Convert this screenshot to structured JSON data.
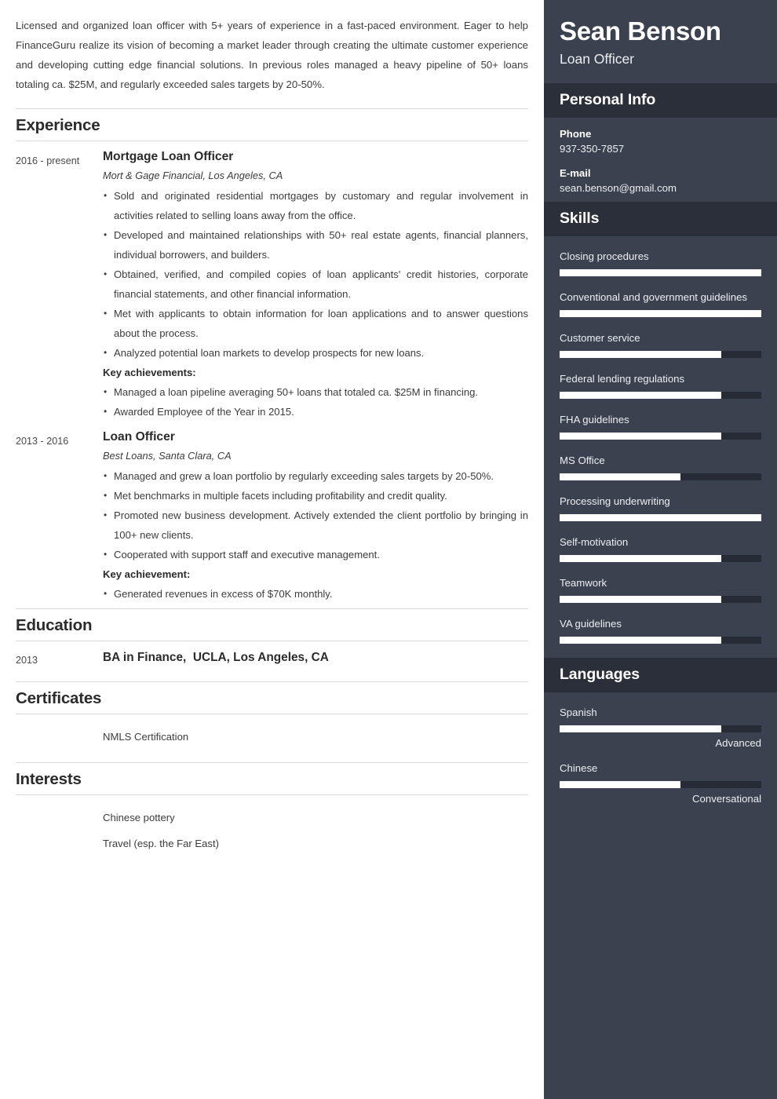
{
  "summary": "Licensed and organized loan officer with 5+ years of experience in a fast-paced environment. Eager to help FinanceGuru realize its vision of becoming a market leader through creating the ultimate customer experience and developing cutting edge financial solutions. In previous roles managed a heavy pipeline of 50+ loans totaling ca. $25M, and regularly exceeded sales targets by 20-50%.",
  "sections": {
    "experience_title": "Experience",
    "education_title": "Education",
    "certificates_title": "Certificates",
    "interests_title": "Interests"
  },
  "experience": [
    {
      "date": "2016 - present",
      "title": "Mortgage Loan Officer",
      "meta": "Mort & Gage Financial, Los Angeles, CA",
      "bullets": [
        "Sold and originated residential mortgages by customary and regular involvement in activities related to selling loans away from the office.",
        "Developed and maintained relationships with 50+ real estate agents, financial planners, individual borrowers, and builders.",
        "Obtained, verified, and compiled copies of loan applicants' credit histories, corporate financial statements, and other financial information.",
        "Met with applicants to obtain information for loan applications and to answer questions about the process.",
        "Analyzed potential loan markets to develop prospects for new loans."
      ],
      "achievements_label": "Key achievements:",
      "achievements": [
        "Managed a loan pipeline averaging 50+ loans that totaled ca. $25M in financing.",
        "Awarded Employee of the Year in 2015."
      ]
    },
    {
      "date": "2013 - 2016",
      "title": "Loan Officer",
      "meta": "Best Loans, Santa Clara, CA",
      "bullets": [
        "Managed and grew a loan portfolio by regularly exceeding sales targets by 20-50%.",
        "Met benchmarks in multiple facets including profitability and credit quality.",
        "Promoted new business development. Actively extended the client portfolio by bringing in 100+ new clients.",
        "Cooperated with support staff and executive management."
      ],
      "achievements_label": "Key achievement:",
      "achievements": [
        "Generated revenues in excess of $70K monthly."
      ]
    }
  ],
  "education": [
    {
      "date": "2013",
      "degree": "BA in Finance,  UCLA, Los Angeles, CA"
    }
  ],
  "certificates": [
    {
      "name": "NMLS Certification"
    }
  ],
  "interests": [
    {
      "name": "Chinese pottery"
    },
    {
      "name": "Travel (esp. the Far East)"
    }
  ],
  "sidebar": {
    "name": "Sean Benson",
    "role": "Loan Officer",
    "personal_info_title": "Personal Info",
    "phone_label": "Phone",
    "phone_value": "937-350-7857",
    "email_label": "E-mail",
    "email_value": "sean.benson@gmail.com",
    "skills_title": "Skills",
    "skills": [
      {
        "name": "Closing procedures",
        "level": 100
      },
      {
        "name": "Conventional and government guidelines",
        "level": 100
      },
      {
        "name": "Customer service",
        "level": 80
      },
      {
        "name": "Federal lending regulations",
        "level": 80
      },
      {
        "name": "FHA guidelines",
        "level": 80
      },
      {
        "name": "MS Office",
        "level": 60
      },
      {
        "name": "Processing underwriting",
        "level": 100
      },
      {
        "name": "Self-motivation",
        "level": 80
      },
      {
        "name": "Teamwork",
        "level": 80
      },
      {
        "name": "VA guidelines",
        "level": 80
      }
    ],
    "languages_title": "Languages",
    "languages": [
      {
        "name": "Spanish",
        "level": 80,
        "label": "Advanced"
      },
      {
        "name": "Chinese",
        "level": 60,
        "label": "Conversational"
      }
    ]
  },
  "colors": {
    "sidebar_bg": "#3b414f",
    "sidebar_header_bg": "#2a2f3a",
    "bar_track": "#262b35",
    "bar_fill": "#ffffff",
    "rule": "#d8d8d8"
  }
}
